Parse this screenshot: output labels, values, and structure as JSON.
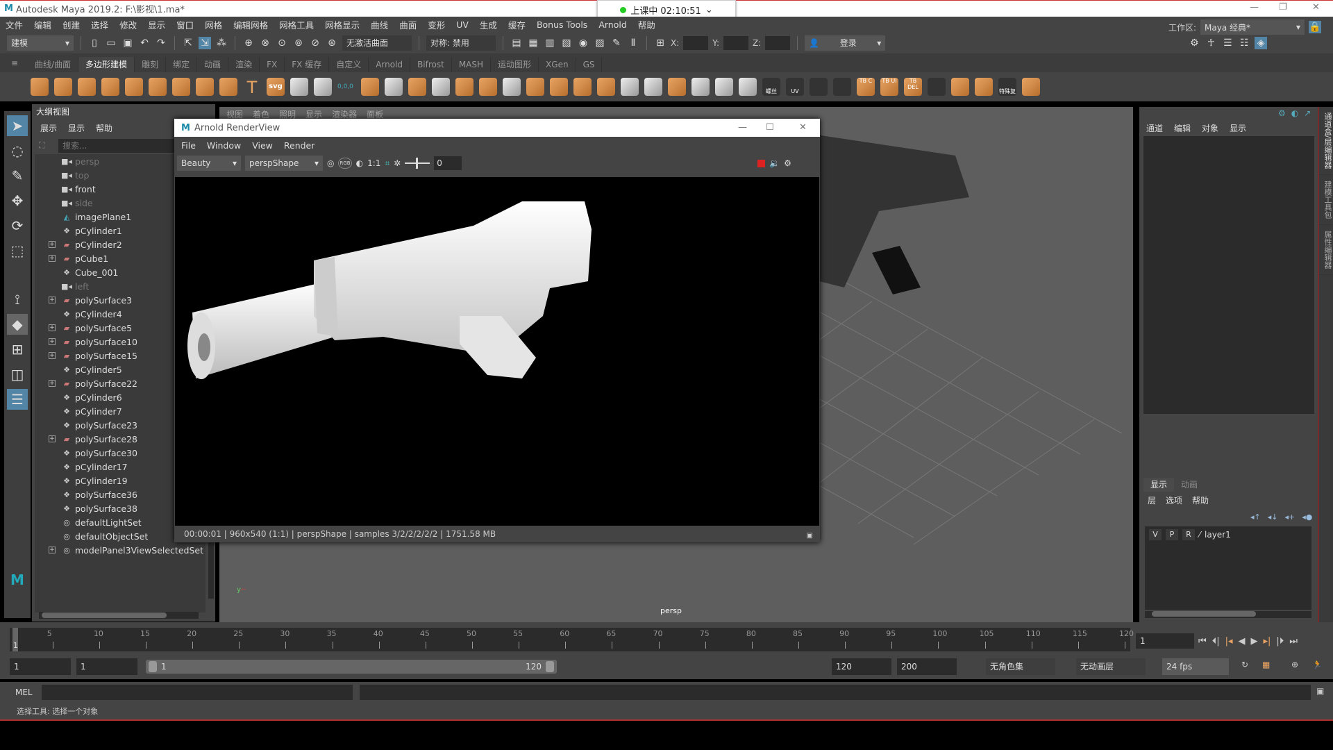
{
  "title": {
    "app": "Autodesk Maya 2019.2: F:\\影视\\1.ma*",
    "clock": "上课中 02:10:51",
    "minimize": "—",
    "restore": "❐",
    "close": "✕"
  },
  "menubar": [
    "文件",
    "编辑",
    "创建",
    "选择",
    "修改",
    "显示",
    "窗口",
    "网格",
    "编辑网格",
    "网格工具",
    "网格显示",
    "曲线",
    "曲面",
    "变形",
    "UV",
    "生成",
    "缓存",
    "Bonus Tools",
    "Arnold",
    "帮助"
  ],
  "toolbar": {
    "mode": "建模",
    "live_surface": "无激活曲面",
    "symmetry": "对称: 禁用",
    "x_label": "X:",
    "y_label": "Y:",
    "z_label": "Z:",
    "login": "登录",
    "workspace_label": "工作区:",
    "workspace": "Maya 经典*"
  },
  "shelf_tabs": [
    "曲线/曲面",
    "多边形建模",
    "雕刻",
    "绑定",
    "动画",
    "渲染",
    "FX",
    "FX 缓存",
    "自定义",
    "Arnold",
    "Bifrost",
    "MASH",
    "运动图形",
    "XGen",
    "GS"
  ],
  "shelf_active": 1,
  "shelf_labels": {
    "svg": "svg",
    "coords": "0,0,0",
    "bolt": "螺丝",
    "uv": "UV",
    "tb_c": "TB C",
    "tb_ui": "TB UI",
    "tb_del": "TB DEL",
    "special": "特殊复"
  },
  "outliner": {
    "tab": "大纲视图",
    "menu": [
      "展示",
      "显示",
      "帮助"
    ],
    "search_placeholder": "搜索...",
    "items": [
      {
        "name": "persp",
        "type": "camera",
        "dim": true,
        "expand": false
      },
      {
        "name": "top",
        "type": "camera",
        "dim": true,
        "expand": false
      },
      {
        "name": "front",
        "type": "camera",
        "dim": false,
        "expand": false
      },
      {
        "name": "side",
        "type": "camera",
        "dim": true,
        "expand": false
      },
      {
        "name": "imagePlane1",
        "type": "imageplane",
        "dim": false,
        "expand": false
      },
      {
        "name": "pCylinder1",
        "type": "mesh",
        "dim": false,
        "expand": false
      },
      {
        "name": "pCylinder2",
        "type": "group",
        "dim": false,
        "expand": true
      },
      {
        "name": "pCube1",
        "type": "group",
        "dim": false,
        "expand": true
      },
      {
        "name": "Cube_001",
        "type": "mesh",
        "dim": false,
        "expand": false
      },
      {
        "name": "left",
        "type": "camera",
        "dim": true,
        "expand": false
      },
      {
        "name": "polySurface3",
        "type": "group",
        "dim": false,
        "expand": true
      },
      {
        "name": "pCylinder4",
        "type": "mesh",
        "dim": false,
        "expand": false
      },
      {
        "name": "polySurface5",
        "type": "group",
        "dim": false,
        "expand": true
      },
      {
        "name": "polySurface10",
        "type": "group",
        "dim": false,
        "expand": true
      },
      {
        "name": "polySurface15",
        "type": "group",
        "dim": false,
        "expand": true
      },
      {
        "name": "pCylinder5",
        "type": "mesh",
        "dim": false,
        "expand": false
      },
      {
        "name": "polySurface22",
        "type": "group",
        "dim": false,
        "expand": true
      },
      {
        "name": "pCylinder6",
        "type": "mesh",
        "dim": false,
        "expand": false
      },
      {
        "name": "pCylinder7",
        "type": "mesh",
        "dim": false,
        "expand": false
      },
      {
        "name": "polySurface23",
        "type": "mesh",
        "dim": false,
        "expand": false
      },
      {
        "name": "polySurface28",
        "type": "group",
        "dim": false,
        "expand": true
      },
      {
        "name": "polySurface30",
        "type": "mesh",
        "dim": false,
        "expand": false
      },
      {
        "name": "pCylinder17",
        "type": "mesh",
        "dim": false,
        "expand": false
      },
      {
        "name": "pCylinder19",
        "type": "mesh",
        "dim": false,
        "expand": false
      },
      {
        "name": "polySurface36",
        "type": "mesh",
        "dim": false,
        "expand": false
      },
      {
        "name": "polySurface38",
        "type": "mesh",
        "dim": false,
        "expand": false
      },
      {
        "name": "defaultLightSet",
        "type": "set",
        "dim": false,
        "expand": false
      },
      {
        "name": "defaultObjectSet",
        "type": "set",
        "dim": false,
        "expand": false
      },
      {
        "name": "modelPanel3ViewSelectedSet",
        "type": "set",
        "dim": false,
        "expand": true
      }
    ]
  },
  "viewport": {
    "menu": [
      "视图",
      "着色",
      "照明",
      "显示",
      "渲染器",
      "面板"
    ],
    "camera_label": "persp"
  },
  "renderview": {
    "title": "Arnold RenderView",
    "menu": [
      "File",
      "Window",
      "View",
      "Render"
    ],
    "aov": "Beauty",
    "camera": "perspShape",
    "ratio": "1:1",
    "exposure": "0",
    "rgb": "RGB",
    "status": "00:00:01 | 960x540 (1:1) | perspShape  | samples 3/2/2/2/2/2 | 1751.58 MB"
  },
  "channelbox": {
    "menu": [
      "通道",
      "编辑",
      "对象",
      "显示"
    ],
    "layer_tabs": [
      "显示",
      "动画"
    ],
    "layer_menu": [
      "层",
      "选项",
      "帮助"
    ],
    "layers": [
      {
        "v": "V",
        "p": "P",
        "r": "R",
        "name": "layer1"
      }
    ]
  },
  "side_tabs": [
    "通道盒/层编辑器",
    "建模工具包",
    "属性编辑器"
  ],
  "timeline": {
    "ticks": [
      1,
      5,
      10,
      15,
      20,
      25,
      30,
      35,
      40,
      45,
      50,
      55,
      60,
      65,
      70,
      75,
      80,
      85,
      90,
      95,
      100,
      105,
      110,
      115,
      120
    ],
    "start": 1,
    "end": 120,
    "current": "1"
  },
  "range": {
    "start": "1",
    "playstart": "1",
    "slider_start": "1",
    "slider_end": "120",
    "playend": "120",
    "end": "200",
    "char_set": "无角色集",
    "anim_layer": "无动画层",
    "fps": "24 fps"
  },
  "mel": {
    "label": "MEL"
  },
  "status": "选择工具: 选择一个对象",
  "colors": {
    "accent": "#5285a6",
    "shelf_orange": "#e8a463",
    "panel": "#444444",
    "field": "#2b2b2b",
    "record": "#dd2222"
  }
}
